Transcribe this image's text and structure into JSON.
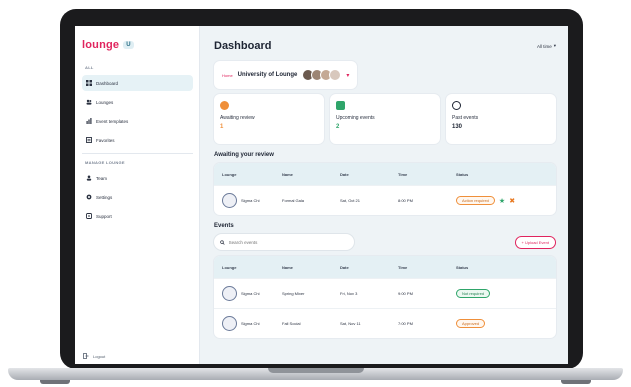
{
  "sidebar": {
    "logo": "lounge",
    "logo_badge": "U",
    "section_main": "ALL",
    "items": [
      {
        "label": "Dashboard",
        "icon": "grid-icon"
      },
      {
        "label": "Lounges",
        "icon": "people-icon"
      },
      {
        "label": "Event templates",
        "icon": "chart-icon"
      },
      {
        "label": "Favorites",
        "icon": "list-icon"
      }
    ],
    "section_manage": "MANAGE LOUNGE",
    "manage_items": [
      {
        "label": "Team",
        "icon": "team-icon"
      },
      {
        "label": "Settings",
        "icon": "gear-icon"
      },
      {
        "label": "Support",
        "icon": "support-icon"
      }
    ],
    "footer": "Logout"
  },
  "header": {
    "title": "Dashboard",
    "filter": "All time"
  },
  "university": {
    "tag": "Home",
    "name": "University of Lounge"
  },
  "stats": [
    {
      "label": "Awaiting review",
      "value": "1",
      "color": "#ef8f3a"
    },
    {
      "label": "Upcoming events",
      "value": "2",
      "color": "#2fa56a"
    },
    {
      "label": "Past events",
      "value": "130",
      "color": "#1d2433"
    }
  ],
  "awaiting": {
    "title": "Awaiting your review",
    "columns": [
      "Lounge",
      "Name",
      "Date",
      "Time",
      "Status"
    ],
    "rows": [
      {
        "lounge": "Sigma Chi",
        "name": "Formal Gala",
        "date": "Sat, Oct 21",
        "time": "8:00 PM",
        "status": "Action required"
      }
    ]
  },
  "events": {
    "title": "Events",
    "search_placeholder": "Search events",
    "add_label": "+ Upload Event",
    "columns": [
      "Lounge",
      "Name",
      "Date",
      "Time",
      "Status"
    ],
    "rows": [
      {
        "lounge": "Sigma Chi",
        "name": "Spring Mixer",
        "date": "Fri, Nov 3",
        "time": "9:00 PM",
        "status": "Not required"
      },
      {
        "lounge": "Sigma Chi",
        "name": "Fall Social",
        "date": "Sat, Nov 11",
        "time": "7:00 PM",
        "status": "Approved"
      }
    ]
  }
}
